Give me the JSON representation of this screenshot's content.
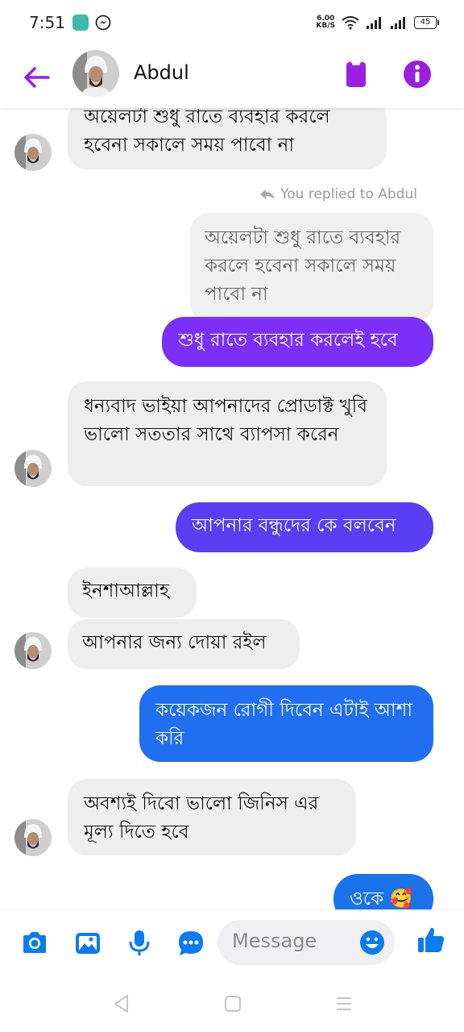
{
  "status_bar": {
    "time": "7:51",
    "net_speed_value": "6.00",
    "net_speed_unit": "KB/S",
    "battery": "45"
  },
  "header": {
    "contact_name": "Abdul",
    "accent_color": "#9b1fe0"
  },
  "chat": {
    "messages": [
      {
        "direction": "incoming",
        "text": "অয়েলটা শুধু রাতে ব্যবহার করলে হবেনা সকালে সময় পাবো না"
      },
      {
        "direction": "outgoing",
        "reply_note": "You replied to Abdul",
        "quoted_text": "অয়েলটা শুধু রাতে ব্যবহার করলে হবেনা সকালে সময় পাবো না",
        "text": "শুধু রাতে ব্যবহার করলেই হবে",
        "color": "#7b2ff7"
      },
      {
        "direction": "incoming",
        "text": "ধন্যবাদ ভাইয়া আপনাদের প্রোডাক্ট খুবি ভালো সততার সাথে ব্যাপসা করেন"
      },
      {
        "direction": "outgoing",
        "text": "আপনার বন্ধুদের কে বলবেন",
        "color": "#5a3ef3"
      },
      {
        "direction": "incoming",
        "text": "ইনশাআল্লাহ"
      },
      {
        "direction": "incoming",
        "text": "আপনার জন্য দোয়া রইল"
      },
      {
        "direction": "outgoing",
        "text": "কয়েকজন রোগী দিবেন এটাই আশা করি",
        "color": "#1f6ff0"
      },
      {
        "direction": "incoming",
        "text": "অবশ্যই দিবো ভালো জিনিস এর মূল্য দিতে হবে"
      },
      {
        "direction": "outgoing",
        "text": "ওকে 🥰",
        "color": "#1a73ea"
      }
    ]
  },
  "composer": {
    "placeholder": "Message",
    "icon_color": "#0a7cf0"
  }
}
